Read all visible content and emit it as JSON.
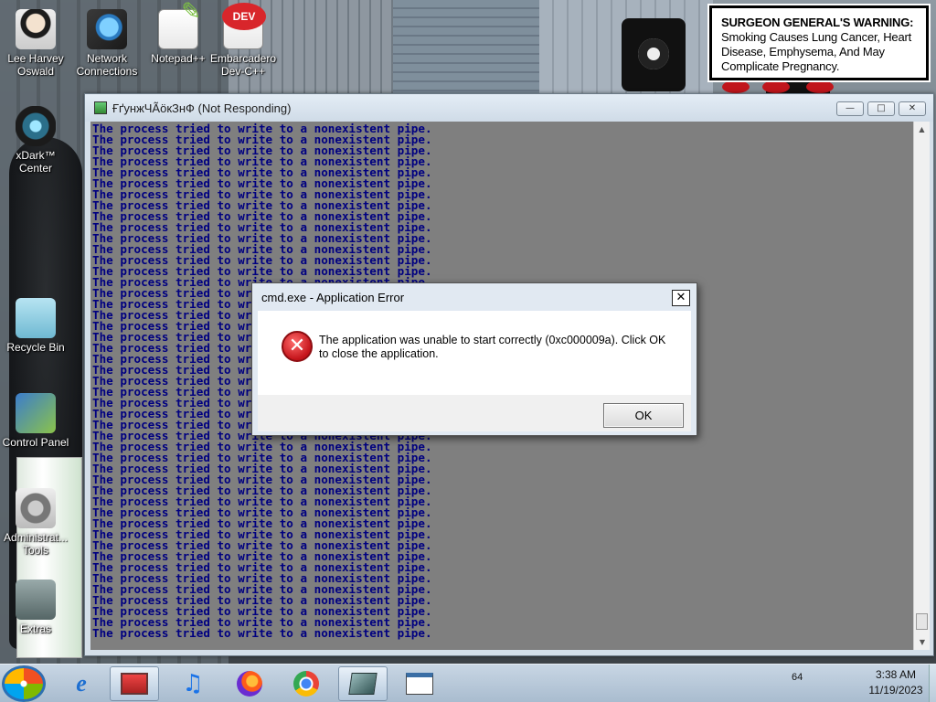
{
  "desktop": {
    "icons": [
      {
        "label": "Lee Harvey Oswald"
      },
      {
        "label": "Network Connections"
      },
      {
        "label": "Notepad++"
      },
      {
        "label": "Embarcadero Dev-C++"
      },
      {
        "label": "xDark™ Center"
      },
      {
        "label": "Recycle Bin"
      },
      {
        "label": "Control Panel"
      },
      {
        "label": "Administrat... Tools"
      },
      {
        "label": "Extras"
      }
    ],
    "warning": {
      "title": "SURGEON GENERAL'S WARNING:",
      "text": "Smoking Causes Lung Cancer, Heart Disease, Emphysema, And May Complicate Pregnancy."
    }
  },
  "console": {
    "title": "ҒґунжЧÃӧкЗнФ (Not Responding)",
    "line_text": "The process tried to write to a nonexistent pipe.",
    "controls": {
      "minimize": "—",
      "maximize": "□",
      "close": "✕"
    }
  },
  "dialog": {
    "title": "cmd.exe - Application Error",
    "message": "The application was unable to start correctly (0xc000009a). Click OK to close the application.",
    "ok_label": "OK",
    "close_glyph": "✕",
    "icon_glyph": "✕"
  },
  "taskbar": {
    "ie_glyph": "e",
    "music_glyph": "♫",
    "tray_text": "64",
    "time": "3:38 AM",
    "date": "11/19/2023"
  }
}
